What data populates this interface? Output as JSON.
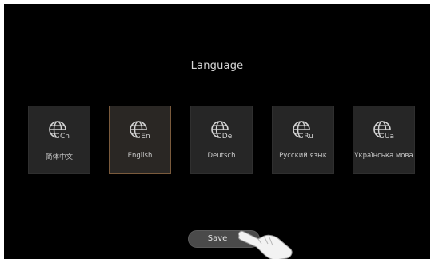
{
  "screen": {
    "title": "Language"
  },
  "languages": [
    {
      "code": "Cn",
      "label": "简体中文",
      "selected": false
    },
    {
      "code": "En",
      "label": "English",
      "selected": true
    },
    {
      "code": "De",
      "label": "Deutsch",
      "selected": false
    },
    {
      "code": "Ru",
      "label": "Русский язык",
      "selected": false
    },
    {
      "code": "Ua",
      "label": "Українська мова",
      "selected": false
    }
  ],
  "save": {
    "label": "Save"
  },
  "icons": {
    "language": "globe-icon",
    "pointer": "pointing-hand-icon"
  },
  "colors": {
    "background": "#000000",
    "card": "#262626",
    "selected_border": "#7a5a3c",
    "text": "#c9c9c9"
  }
}
